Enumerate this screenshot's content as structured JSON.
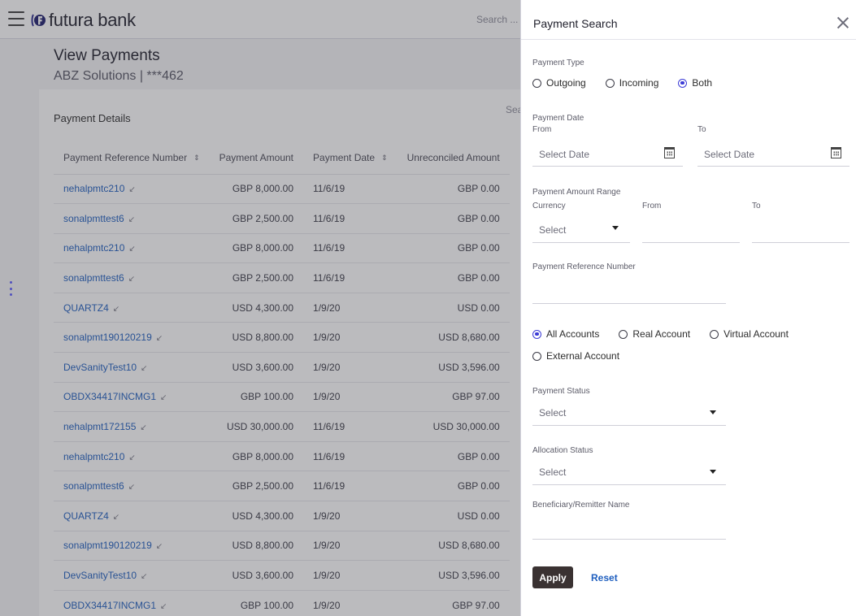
{
  "header": {
    "brand": "futura bank",
    "search_placeholder": "Search ..."
  },
  "page": {
    "title": "View Payments",
    "subtitle": "ABZ Solutions | ***462"
  },
  "card": {
    "title": "Payment Details",
    "search_partial": "Sea"
  },
  "table": {
    "columns": [
      "Payment Reference Number",
      "Payment Amount",
      "Payment Date",
      "Unreconciled Amount"
    ],
    "rows": [
      {
        "ref": "nehalpmtc210",
        "amount": "GBP 8,000.00",
        "date": "11/6/19",
        "unreconciled": "GBP 0.00"
      },
      {
        "ref": "sonalpmttest6",
        "amount": "GBP 2,500.00",
        "date": "11/6/19",
        "unreconciled": "GBP 0.00"
      },
      {
        "ref": "nehalpmtc210",
        "amount": "GBP 8,000.00",
        "date": "11/6/19",
        "unreconciled": "GBP 0.00"
      },
      {
        "ref": "sonalpmttest6",
        "amount": "GBP 2,500.00",
        "date": "11/6/19",
        "unreconciled": "GBP 0.00"
      },
      {
        "ref": "QUARTZ4",
        "amount": "USD 4,300.00",
        "date": "1/9/20",
        "unreconciled": "USD 0.00"
      },
      {
        "ref": "sonalpmt190120219",
        "amount": "USD 8,800.00",
        "date": "1/9/20",
        "unreconciled": "USD 8,680.00"
      },
      {
        "ref": "DevSanityTest10",
        "amount": "USD 3,600.00",
        "date": "1/9/20",
        "unreconciled": "USD 3,596.00"
      },
      {
        "ref": "OBDX34417INCMG1",
        "amount": "GBP 100.00",
        "date": "1/9/20",
        "unreconciled": "GBP 97.00"
      },
      {
        "ref": "nehalpmt172155",
        "amount": "USD 30,000.00",
        "date": "11/6/19",
        "unreconciled": "USD 30,000.00"
      },
      {
        "ref": "nehalpmtc210",
        "amount": "GBP 8,000.00",
        "date": "11/6/19",
        "unreconciled": "GBP 0.00"
      },
      {
        "ref": "sonalpmttest6",
        "amount": "GBP 2,500.00",
        "date": "11/6/19",
        "unreconciled": "GBP 0.00"
      },
      {
        "ref": "QUARTZ4",
        "amount": "USD 4,300.00",
        "date": "1/9/20",
        "unreconciled": "USD 0.00"
      },
      {
        "ref": "sonalpmt190120219",
        "amount": "USD 8,800.00",
        "date": "1/9/20",
        "unreconciled": "USD 8,680.00"
      },
      {
        "ref": "DevSanityTest10",
        "amount": "USD 3,600.00",
        "date": "1/9/20",
        "unreconciled": "USD 3,596.00"
      },
      {
        "ref": "OBDX34417INCMG1",
        "amount": "GBP 100.00",
        "date": "1/9/20",
        "unreconciled": "GBP 97.00"
      }
    ]
  },
  "panel": {
    "title": "Payment Search",
    "payment_type": {
      "label": "Payment Type",
      "options": [
        "Outgoing",
        "Incoming",
        "Both"
      ],
      "selected": "Both"
    },
    "payment_date": {
      "label": "Payment Date",
      "from_label": "From",
      "to_label": "To",
      "from_placeholder": "Select Date",
      "to_placeholder": "Select Date"
    },
    "amount_range": {
      "label": "Payment Amount Range",
      "currency_label": "Currency",
      "from_label": "From",
      "to_label": "To",
      "currency_value": "Select"
    },
    "reference": {
      "label": "Payment Reference Number"
    },
    "accounts": {
      "options": [
        "All Accounts",
        "Real Account",
        "Virtual Account",
        "External Account"
      ],
      "selected": "All Accounts"
    },
    "payment_status": {
      "label": "Payment Status",
      "value": "Select"
    },
    "allocation_status": {
      "label": "Allocation Status",
      "value": "Select"
    },
    "beneficiary": {
      "label": "Beneficiary/Remitter Name"
    },
    "apply_label": "Apply",
    "reset_label": "Reset"
  },
  "colors": {
    "link": "#1f5fbf",
    "radio_selected": "#3b3bd6",
    "apply_button": "#3a3232"
  }
}
